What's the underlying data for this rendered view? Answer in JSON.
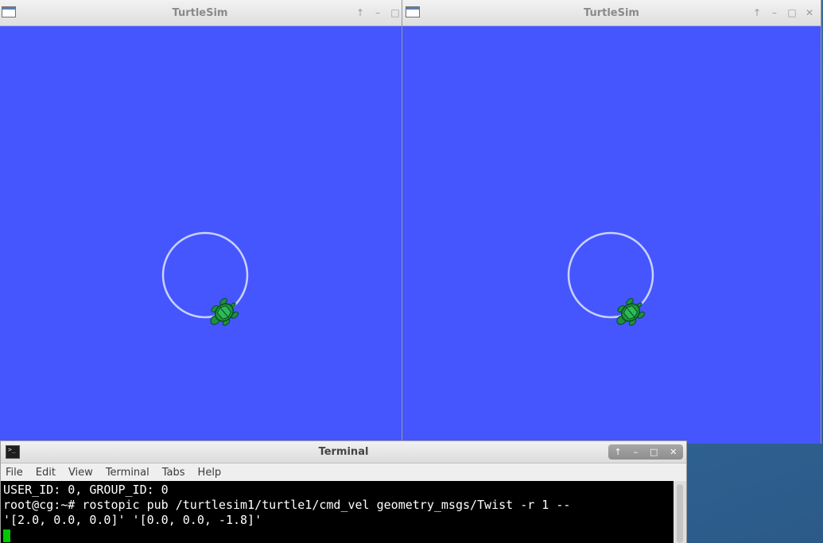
{
  "windows": {
    "left": {
      "title": "TurtleSim",
      "controls": [
        "↑",
        "–",
        "□"
      ]
    },
    "right": {
      "title": "TurtleSim",
      "controls": [
        "↑",
        "–",
        "□",
        "✕"
      ]
    }
  },
  "terminal": {
    "title": "Terminal",
    "controls": [
      "↑",
      "–",
      "□",
      "✕"
    ],
    "menu": [
      "File",
      "Edit",
      "View",
      "Terminal",
      "Tabs",
      "Help"
    ],
    "lines": [
      "USER_ID: 0, GROUP_ID: 0",
      "root@cg:~# rostopic pub /turtlesim1/turtle1/cmd_vel geometry_msgs/Twist -r 1 --",
      "'[2.0, 0.0, 0.0]' '[0.0, 0.0, -1.8]'"
    ]
  },
  "colors": {
    "sim_background": "#4556ff",
    "trail": "#c8d2ff",
    "turtle_shell": "#1a9a3c",
    "cursor": "#00c800"
  },
  "icons": {
    "window_icon": "window-icon",
    "terminal_icon": "terminal-icon",
    "turtle": "turtle-icon"
  }
}
